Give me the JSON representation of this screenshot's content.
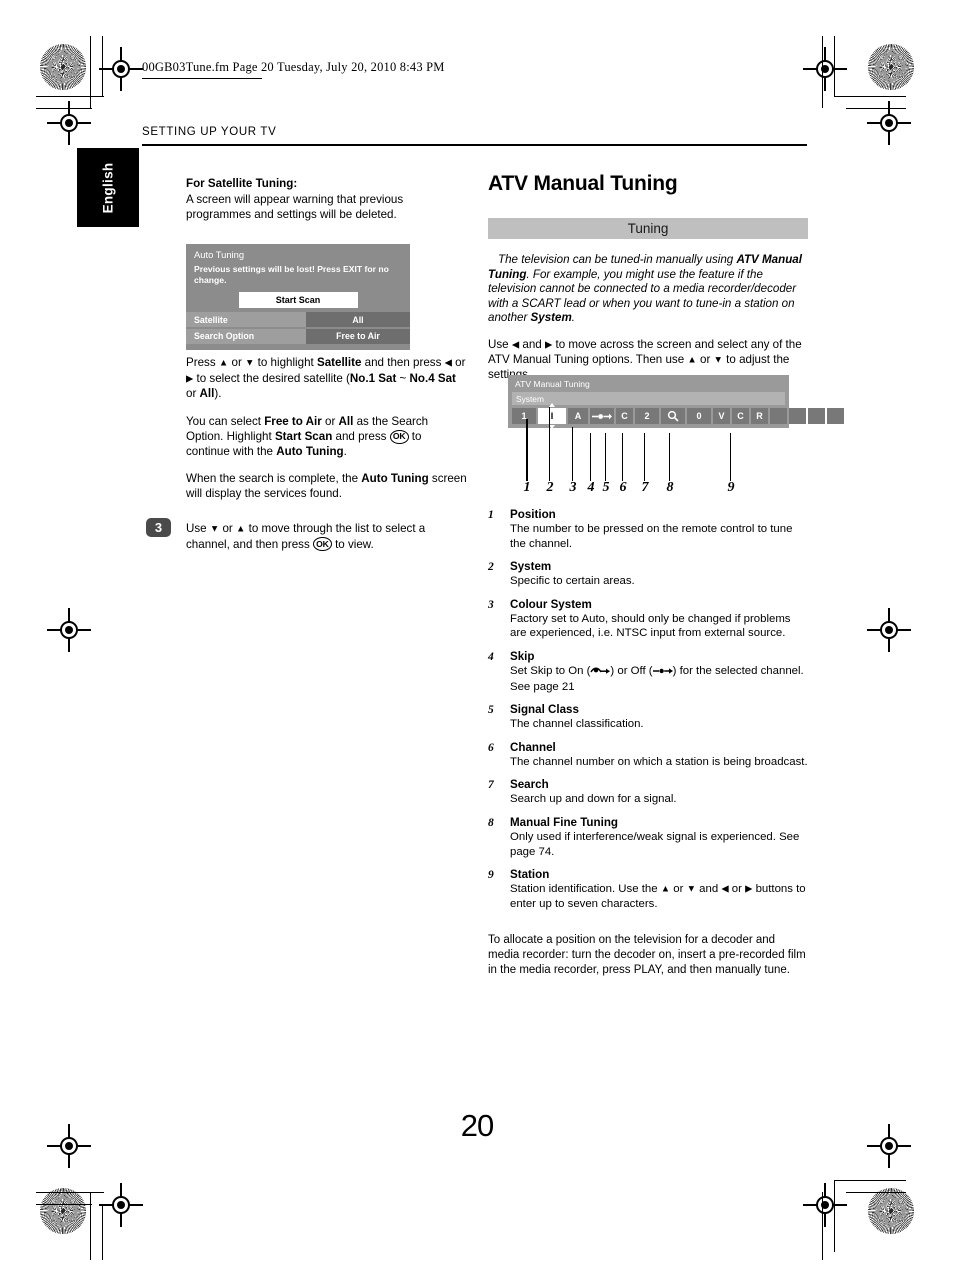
{
  "page": {
    "file_info": "00GB03Tune.fm  Page 20  Tuesday, July 20, 2010  8:43 PM",
    "running_head": "SETTING UP YOUR TV",
    "language_tab": "English",
    "page_number": "20"
  },
  "left": {
    "satellite_heading": "For Satellite Tuning:",
    "satellite_intro": "A screen will appear warning that previous programmes and settings will be deleted.",
    "osd_auto_tuning": {
      "title": "Auto Tuning",
      "warning": "Previous settings will be lost! Press EXIT for no change.",
      "start_scan_button": "Start Scan",
      "rows": [
        {
          "label": "Satellite",
          "value": "All"
        },
        {
          "label": "Search Option",
          "value": "Free to Air"
        }
      ]
    },
    "para_press_prefix": "Press ",
    "para_press": "or ",
    "para_press_2": " to highlight ",
    "satellite_bold": "Satellite",
    "para_press_3": " and then press ",
    "para_press_4": " or",
    "para_press_5": " to select the desired satellite (",
    "sat_range_1": "No.1 Sat",
    "sat_range_sep": " ~ ",
    "sat_range_2": "No.4 Sat",
    "sat_or": " or ",
    "sat_all": "All",
    "sat_close": ").",
    "para2_a": "You can select ",
    "free_to_air": "Free to Air",
    "para2_b": " or ",
    "all2": "All",
    "para2_c": " as the Search Option. Highlight ",
    "start_scan_bold": "Start Scan",
    "para2_d": " and press ",
    "ok_label": "OK",
    "para2_e": " to continue with the ",
    "auto_tuning_bold": "Auto Tuning",
    "para2_f": ".",
    "para3_a": "When the search is complete, the ",
    "auto_tuning_bold2": "Auto Tuning",
    "para3_b": " screen will display the services found.",
    "step3_number": "3",
    "step3_a": "Use ",
    "step3_b": " or ",
    "step3_c": " to move through the list to select a channel, and then press ",
    "step3_ok": "OK",
    "step3_d": " to view."
  },
  "right": {
    "page_title": "ATV Manual Tuning",
    "section_bar": "Tuning",
    "intro_a": "The television can be tuned-in manually using ",
    "intro_bold1": "ATV Manual Tuning",
    "intro_b": ". For example, you might use the feature if the television cannot be connected to a media recorder/decoder with a SCART lead or when you want to tune-in a station on another ",
    "intro_bold2": "System",
    "intro_c": ".",
    "use_a": "Use ",
    "use_b": " and ",
    "use_c": " to move across the screen and select any of the ATV Manual Tuning options. Then use ",
    "use_d": " or ",
    "use_e": " to adjust the settings.",
    "osd_atv": {
      "title": "ATV Manual Tuning",
      "system_label": "System",
      "cells": [
        "1",
        "I",
        "A",
        "skip-icon",
        "C",
        "2",
        "search-icon",
        "0",
        "V",
        "C",
        "R",
        "",
        "",
        "",
        ""
      ]
    },
    "callout_numbers": [
      "1",
      "2",
      "3",
      "4",
      "5",
      "6",
      "7",
      "8",
      "9"
    ],
    "items": [
      {
        "num": "1",
        "title": "Position",
        "body": "The number to be pressed on the remote control to tune the channel."
      },
      {
        "num": "2",
        "title": "System",
        "body": "Specific to certain areas."
      },
      {
        "num": "3",
        "title": "Colour System",
        "body": "Factory set to Auto, should only be changed if problems are experienced, i.e. NTSC input from external source."
      },
      {
        "num": "4",
        "title": "Skip",
        "body_pre": "Set Skip to On (",
        "body_mid": ") or Off (",
        "body_post": ") for the selected channel. See page 21"
      },
      {
        "num": "5",
        "title": "Signal Class",
        "body": "The channel classification."
      },
      {
        "num": "6",
        "title": "Channel",
        "body": "The channel number on which a station is being broadcast."
      },
      {
        "num": "7",
        "title": "Search",
        "body": "Search up and down for a signal."
      },
      {
        "num": "8",
        "title": "Manual Fine Tuning",
        "body": "Only used if interference/weak signal is experienced. See page 74."
      },
      {
        "num": "9",
        "title": "Station",
        "body_pre": "Station identification. Use the ",
        "body_mid1": " or ",
        "body_mid2": " and ",
        "body_mid3": " or ",
        "body_post": " buttons to enter up to seven characters."
      }
    ],
    "tail_para": "To allocate a position on the television for a decoder and media recorder: turn the decoder on, insert a pre-recorded film in the media recorder, press PLAY, and then manually tune."
  },
  "colors": {
    "osd_bg": "#8c8c8c",
    "osd_label": "#9e9e9e",
    "osd_value": "#6e6e6e",
    "section_bar": "#bfbfbf",
    "atv_bg": "#9a9a9a",
    "cell": "#787878",
    "badge": "#4a4a4a"
  }
}
